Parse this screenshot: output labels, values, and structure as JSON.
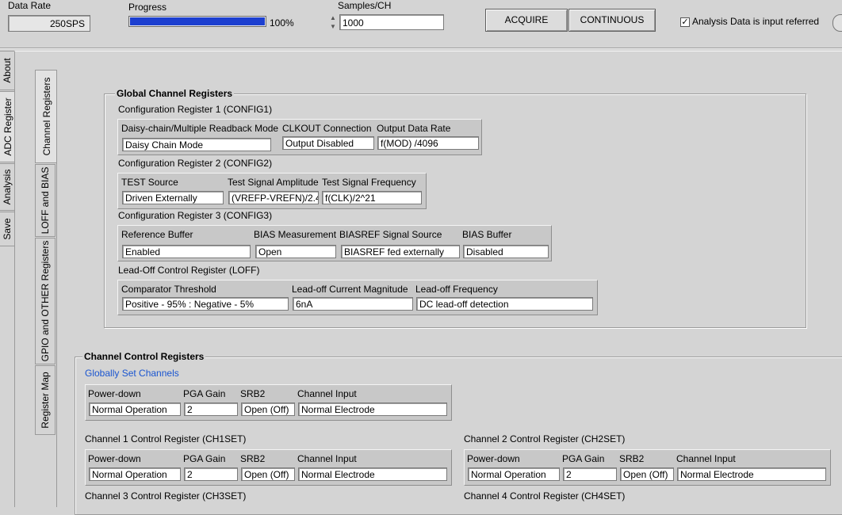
{
  "top": {
    "data_rate_label": "Data Rate",
    "data_rate_value": "250SPS",
    "progress_label": "Progress",
    "progress_value": 1.0,
    "progress_text": "100%",
    "samples_label": "Samples/CH",
    "samples_value": "1000",
    "acquire_label": "ACQUIRE",
    "continuous_label": "CONTINUOUS",
    "analysis_checkbox_label": "Analysis Data is input referred",
    "analysis_checked": true,
    "progress_color": "#1c3fd0"
  },
  "outer_tabs": [
    "About",
    "ADC Register",
    "Analysis",
    "Save"
  ],
  "inner_tabs": [
    "Channel Registers",
    "LOFF and BIAS",
    "GPIO and OTHER Registers",
    "Register Map"
  ],
  "global": {
    "title": "Global Channel Registers",
    "config1": {
      "title": "Configuration Register 1 (CONFIG1)",
      "daisy_label": "Daisy-chain/Multiple Readback Mode",
      "daisy_value": "Daisy Chain Mode",
      "clkout_label": "CLKOUT Connection",
      "clkout_value": "Output Disabled",
      "odr_label": "Output Data Rate",
      "odr_value": "f(MOD) /4096"
    },
    "config2": {
      "title": "Configuration Register 2 (CONFIG2)",
      "test_source_label": "TEST Source",
      "test_source_value": "Driven Externally",
      "amp_label": "Test Signal Amplitude",
      "amp_value": "(VREFP-VREFN)/2.4",
      "freq_label": "Test Signal Frequency",
      "freq_value": "f(CLK)/2^21"
    },
    "config3": {
      "title": "Configuration Register 3 (CONFIG3)",
      "refbuf_label": "Reference Buffer",
      "refbuf_value": "Enabled",
      "biasmeas_label": "BIAS Measurement",
      "biasmeas_value": "Open",
      "biasref_label": "BIASREF Signal Source",
      "biasref_value": "BIASREF fed externally",
      "biasbuf_label": "BIAS Buffer",
      "biasbuf_value": "Disabled"
    },
    "loff": {
      "title": "Lead-Off Control Register (LOFF)",
      "comp_label": "Comparator Threshold",
      "comp_value": "Positive - 95% : Negative - 5%",
      "cur_label": "Lead-off Current Magnitude",
      "cur_value": "6nA",
      "freq_label": "Lead-off Frequency",
      "freq_value": "DC lead-off detection"
    }
  },
  "channels": {
    "title": "Channel Control Registers",
    "global_link": "Globally Set Channels",
    "col_labels": {
      "power": "Power-down",
      "gain": "PGA Gain",
      "srb2": "SRB2",
      "input": "Channel Input"
    },
    "global_row": {
      "power": "Normal Operation",
      "gain": "2",
      "srb2": "Open (Off)",
      "input": "Normal Electrode"
    },
    "ch1": {
      "title": "Channel 1 Control Register (CH1SET)",
      "power": "Normal Operation",
      "gain": "2",
      "srb2": "Open (Off)",
      "input": "Normal Electrode"
    },
    "ch2": {
      "title": "Channel 2 Control Register (CH2SET)",
      "power": "Normal Operation",
      "gain": "2",
      "srb2": "Open (Off)",
      "input": "Normal Electrode"
    },
    "ch3_title": "Channel 3 Control Register (CH3SET)",
    "ch4_title": "Channel 4 Control Register (CH4SET)"
  }
}
